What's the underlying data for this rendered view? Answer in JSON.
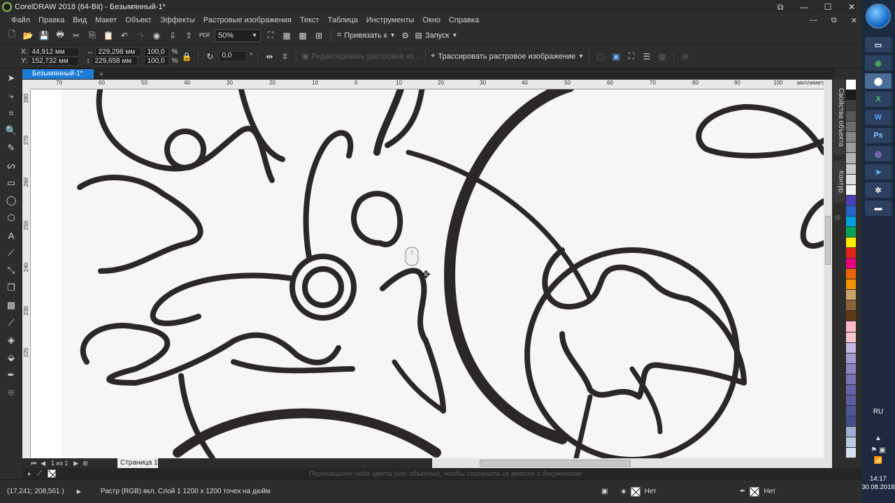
{
  "window": {
    "title": "CorelDRAW 2018 (64-Bit) - Безымянный-1*"
  },
  "menu": [
    "Файл",
    "Правка",
    "Вид",
    "Макет",
    "Объект",
    "Эффекты",
    "Растровые изображения",
    "Текст",
    "Таблица",
    "Инструменты",
    "Окно",
    "Справка"
  ],
  "std_toolbar": {
    "zoom": "50%",
    "snap_label": "Привязать к",
    "launch_label": "Запуск",
    "pdf_label": "PDF"
  },
  "property_bar": {
    "x_label": "X:",
    "x_value": "44,912 мм",
    "y_label": "Y:",
    "y_value": "152,732 мм",
    "w_value": "229,298 мм",
    "h_value": "229,658 мм",
    "scale_w": "100,0",
    "scale_h": "100,0",
    "percent": "%",
    "rotation": "0,0",
    "degree": "°",
    "edit_bitmap": "Редактировать растровое из...",
    "trace_bitmap": "Трассировать растровое изображение"
  },
  "document": {
    "tab_label": "Безымянный-1*",
    "page_tab": "Страница 1",
    "page_counter": "1  из  1",
    "ruler_units": "миллиметры",
    "hruler_ticks": [
      "70",
      "60",
      "50",
      "40",
      "30",
      "20",
      "10",
      "0",
      "10",
      "20",
      "30",
      "40",
      "50",
      "60",
      "70",
      "80",
      "90",
      "100"
    ],
    "vruler_ticks": [
      "280",
      "270",
      "260",
      "250",
      "240",
      "230",
      "220"
    ]
  },
  "dockers": {
    "object_properties": "Свойства объекта",
    "contour": "Контур"
  },
  "palette": [
    "#ffffff",
    "#1a1a1a",
    "#3d3d3d",
    "#575757",
    "#6d6d6d",
    "#858585",
    "#9c9c9c",
    "#b3b3b3",
    "#cacaca",
    "#e0e0e0",
    "#f2f2f2",
    "#4a3fb6",
    "#2266cc",
    "#00a0e0",
    "#00a651",
    "#ffed00",
    "#e2231a",
    "#e6007e",
    "#ec6608",
    "#f39200",
    "#c9a36a",
    "#8c6239",
    "#603913",
    "#ffb7c5",
    "#f5c6d2",
    "#c0b7e3",
    "#a29bd1",
    "#8a84c2",
    "#7972b5",
    "#6563a8",
    "#5a5ea0",
    "#4f5797",
    "#454f8e",
    "#9bb0d4",
    "#b9cbe4",
    "#d6e2f1"
  ],
  "color_bar": {
    "hint": "Перетащите сюда цвета (или объекты), чтобы сохранить их вместе с документом"
  },
  "status_bar": {
    "coords": "(17,241; 208,561 )",
    "info": "Растр (RGB) вкл. Слой 1 1200 x 1200 точек на дюйм",
    "fill": "Нет",
    "outline": "Нет"
  },
  "taskbar": {
    "language": "RU",
    "time": "14:17",
    "date": "30.08.2018",
    "apps": [
      "explorer",
      "chrome",
      "coreldraw",
      "excel",
      "word",
      "photoshop",
      "viber",
      "telegram",
      "snip",
      "manager"
    ]
  }
}
